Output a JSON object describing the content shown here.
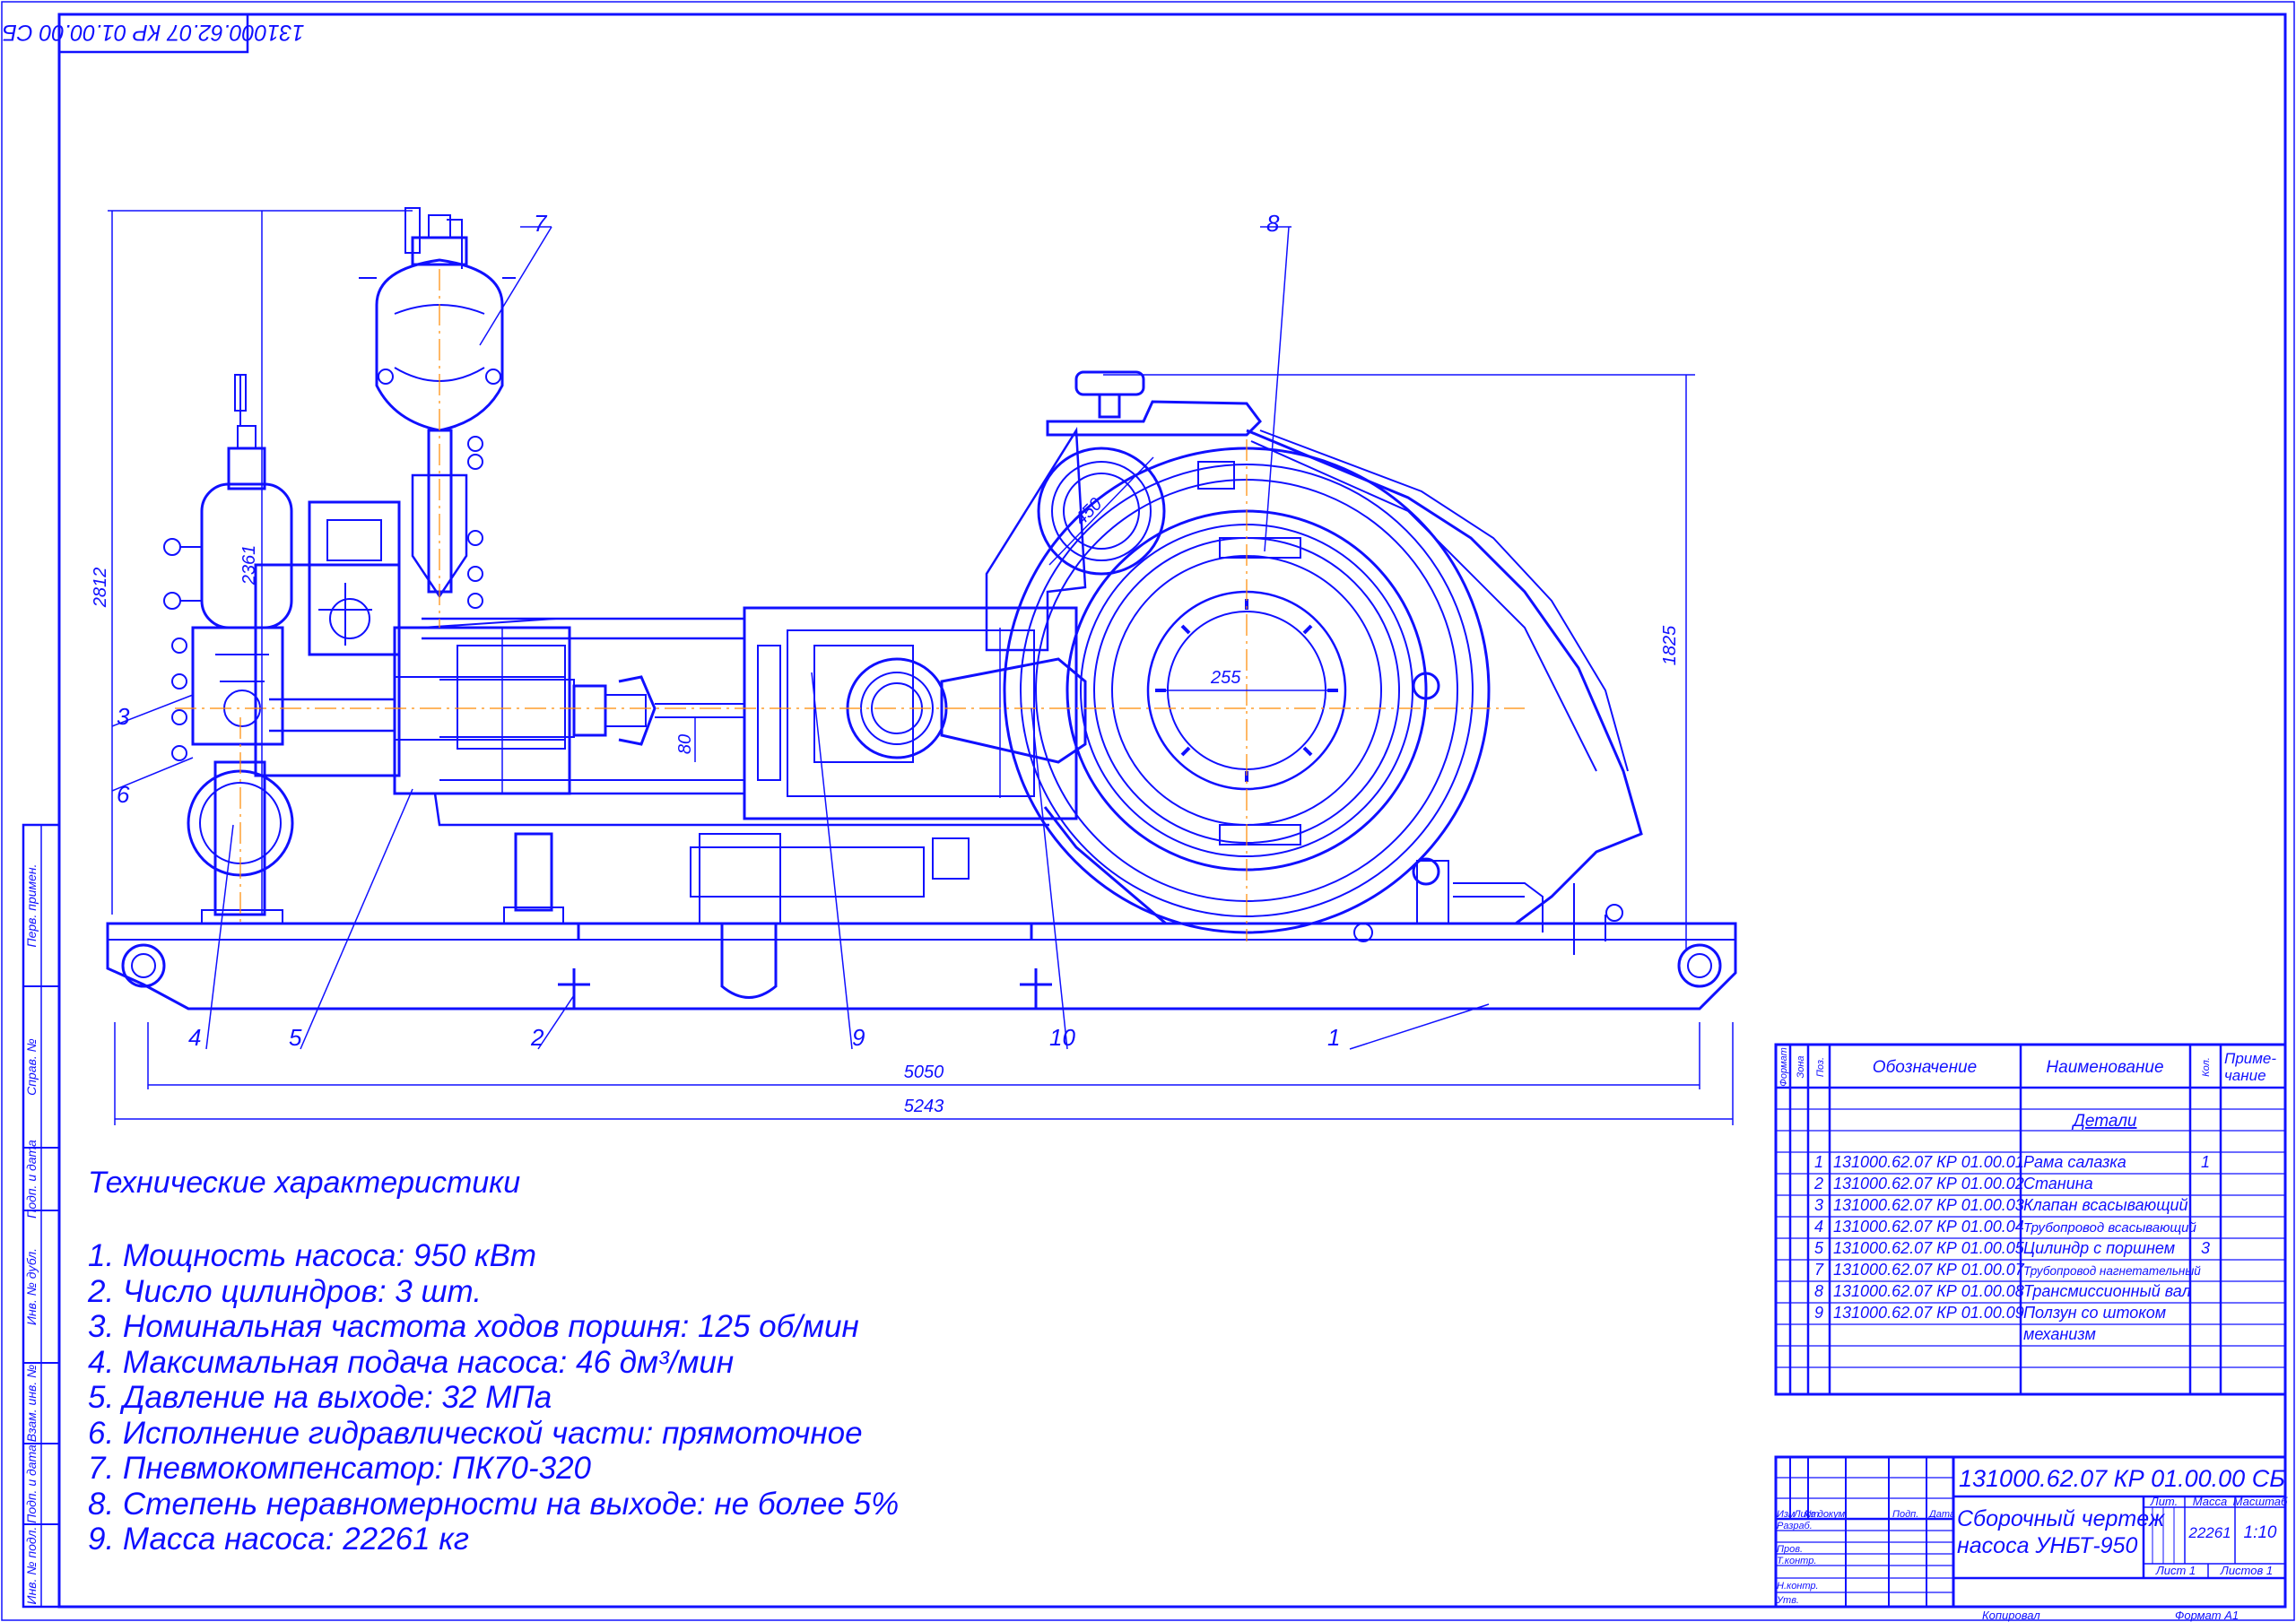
{
  "stamp_rotated": "131000.62.07 КР 01.00.00 СБ",
  "side_columns": [
    "Перв. примен.",
    "Справ. №",
    "Подп. и дата",
    "Инв. № дубл.",
    "Взам. инв. №",
    "Подп. и дата",
    "Инв. № подл."
  ],
  "callouts": [
    "7",
    "8",
    "3",
    "6",
    "4",
    "5",
    "2",
    "9",
    "10",
    "1"
  ],
  "dimensions": {
    "d2812": "2812",
    "d2361": "2361",
    "d1825": "1825",
    "d450": "450",
    "d255": "255",
    "d80": "80",
    "d5050": "5050",
    "d5243": "5243"
  },
  "tech": {
    "title": "Технические характеристики",
    "items": [
      "1. Мощность насоса: 950 кВт",
      "2. Число цилиндров: 3 шт.",
      "3. Номинальная частота ходов поршня: 125 об/мин",
      "4. Максимальная подача насоса: 46 дм³/мин",
      "5. Давление на выходе: 32 МПа",
      "6. Исполнение гидравлической части: прямоточное",
      "7. Пневмокомпенсатор: ПК70-320",
      "8. Степень неравномерности на выходе: не более 5%",
      "9. Масса насоса: 22261 кг"
    ]
  },
  "spec": {
    "headers": {
      "format": "Формат",
      "zone": "Зона",
      "pos": "Поз.",
      "designation": "Обозначение",
      "name": "Наименование",
      "qty": "Кол.",
      "note1": "Приме-",
      "note2": "чание"
    },
    "section": "Детали",
    "rows": [
      {
        "pos": "1",
        "code": "131000.62.07 КР 01.00.01",
        "name": "Рама салазка",
        "qty": "1"
      },
      {
        "pos": "2",
        "code": "131000.62.07 КР 01.00.02",
        "name": "Станина",
        "qty": ""
      },
      {
        "pos": "3",
        "code": "131000.62.07 КР 01.00.03",
        "name": "Клапан всасывающий",
        "qty": ""
      },
      {
        "pos": "4",
        "code": "131000.62.07 КР 01.00.04",
        "name": "Трубопровод всасывающий",
        "qty": ""
      },
      {
        "pos": "5",
        "code": "131000.62.07 КР 01.00.05",
        "name": "Цилиндр с поршнем",
        "qty": "3"
      },
      {
        "pos": "7",
        "code": "131000.62.07 КР 01.00.07",
        "name": "Трубопровод нагнетательный",
        "qty": ""
      },
      {
        "pos": "8",
        "code": "131000.62.07 КР 01.00.08",
        "name": "Трансмиссионный вал",
        "qty": ""
      },
      {
        "pos": "9",
        "code": "131000.62.07 КР 01.00.09",
        "name": "Ползун со штоком",
        "qty": ""
      }
    ],
    "row_extra": "механизм"
  },
  "titleblock": {
    "code": "131000.62.07 КР 01.00.00 СБ",
    "name1": "Сборочный чертеж",
    "name2": "насоса УНБТ-950",
    "lit": "Лит.",
    "mass": "Масса",
    "scale": "Масштаб",
    "mass_val": "22261",
    "scale_val": "1:10",
    "sheet": "Лист 1",
    "sheets": "Листов 1",
    "cols": [
      "Изм",
      "Лист",
      "№ докум.",
      "Подп.",
      "Дата"
    ],
    "roles": [
      "Разраб.",
      "Пров.",
      "Т.контр.",
      "Н.контр.",
      "Утв."
    ]
  },
  "footer": {
    "copied": "Копировал",
    "format": "Формат А1"
  }
}
